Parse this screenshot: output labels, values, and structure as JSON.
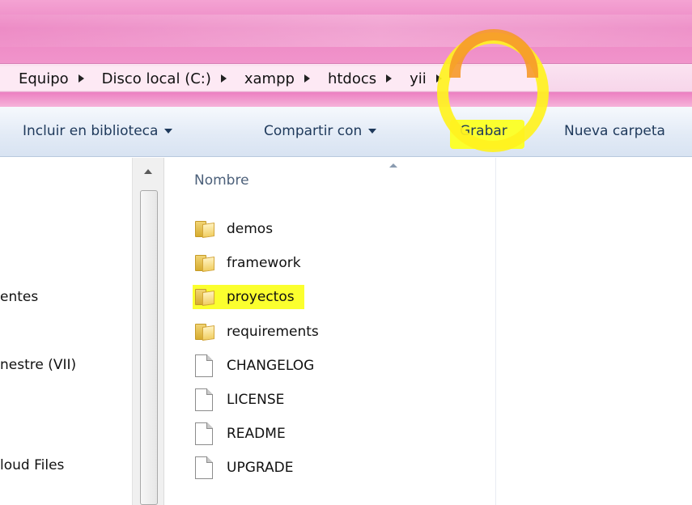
{
  "breadcrumb": [
    "Equipo",
    "Disco local (C:)",
    "xampp",
    "htdocs",
    "yii"
  ],
  "toolbar": {
    "include_library": "Incluir en biblioteca",
    "share_with": "Compartir con",
    "burn": "Grabar",
    "new_folder": "Nueva carpeta"
  },
  "nav_pane": {
    "items": [
      "entes",
      "nestre (VII)",
      "loud Files"
    ]
  },
  "file_list": {
    "column_name": "Nombre",
    "items": [
      {
        "name": "demos",
        "type": "folder"
      },
      {
        "name": "framework",
        "type": "folder"
      },
      {
        "name": "proyectos",
        "type": "folder"
      },
      {
        "name": "requirements",
        "type": "folder"
      },
      {
        "name": "CHANGELOG",
        "type": "file"
      },
      {
        "name": "LICENSE",
        "type": "file"
      },
      {
        "name": "README",
        "type": "file"
      },
      {
        "name": "UPGRADE",
        "type": "file"
      }
    ]
  },
  "colors": {
    "title_pink": "#ec86c3",
    "highlight_yellow": "#fbff2e",
    "circle_orange": "#f79a2a"
  }
}
